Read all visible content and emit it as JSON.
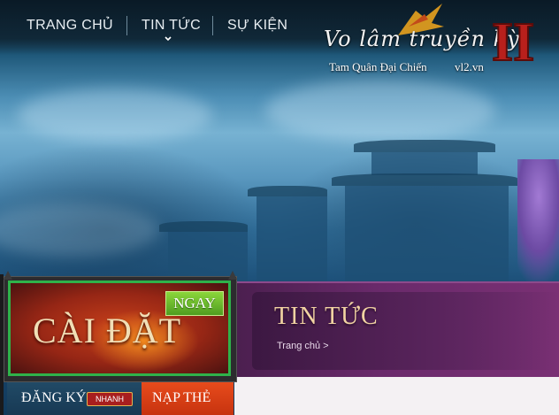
{
  "nav": {
    "items": [
      {
        "label": "TRANG CHỦ"
      },
      {
        "label": "TIN TỨC"
      },
      {
        "label": "SỰ KIỆN"
      }
    ]
  },
  "logo": {
    "script_text": "Vo lâm truyền kỳ",
    "roman_numeral": "II",
    "subtitle": "Tam Quân Đại Chiến",
    "domain": "vl2.vn"
  },
  "install": {
    "label": "CÀI ĐẶT",
    "badge": "NGAY",
    "highlight_color": "#2fb24a"
  },
  "register": {
    "label": "ĐĂNG KÝ",
    "badge": "NHANH"
  },
  "topup": {
    "label": "NẠP THẺ"
  },
  "news": {
    "title": "TIN TỨC",
    "breadcrumb": "Trang chủ >"
  },
  "colors": {
    "news_panel": "#6a2a6b",
    "title_gold": "#f1d3a2",
    "topup_orange": "#e74b1c"
  }
}
